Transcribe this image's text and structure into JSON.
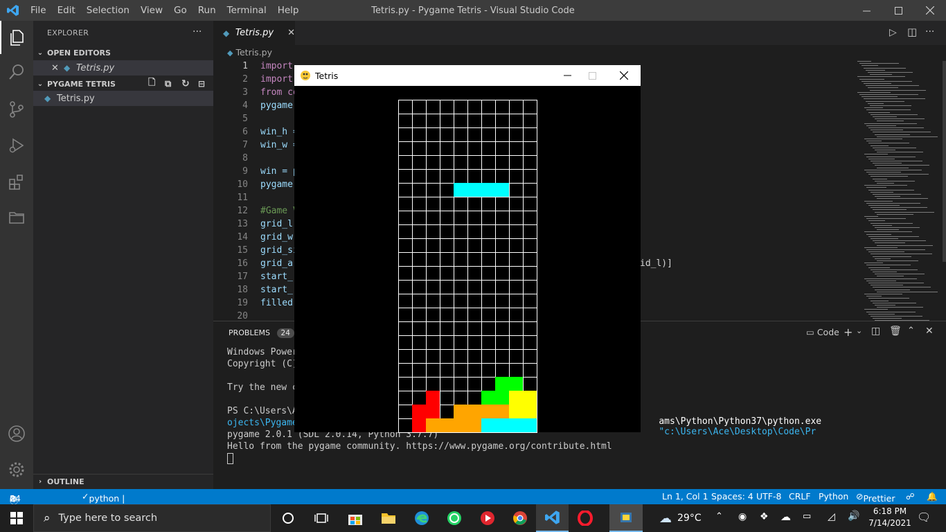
{
  "window": {
    "title": "Tetris.py - Pygame Tetris - Visual Studio Code",
    "menu": [
      "File",
      "Edit",
      "Selection",
      "View",
      "Go",
      "Run",
      "Terminal",
      "Help"
    ]
  },
  "sidebar": {
    "header": "EXPLORER",
    "open_editors_label": "OPEN EDITORS",
    "open_editor_file": "Tetris.py",
    "folder_label": "PYGAME TETRIS",
    "folder_file": "Tetris.py",
    "outline_label": "OUTLINE"
  },
  "editor": {
    "tab_label": "Tetris.py",
    "breadcrumb": "Tetris.py",
    "lines": [
      {
        "num": "1",
        "text": "import"
      },
      {
        "num": "2",
        "text": "import"
      },
      {
        "num": "3",
        "text": "from co"
      },
      {
        "num": "4",
        "text": "pygame"
      },
      {
        "num": "5",
        "text": ""
      },
      {
        "num": "6",
        "text": "win_h ="
      },
      {
        "num": "7",
        "text": "win_w ="
      },
      {
        "num": "8",
        "text": ""
      },
      {
        "num": "9",
        "text": "win = p"
      },
      {
        "num": "10",
        "text": "pygame"
      },
      {
        "num": "11",
        "text": ""
      },
      {
        "num": "12",
        "text": "#Game V"
      },
      {
        "num": "13",
        "text": "grid_l"
      },
      {
        "num": "14",
        "text": "grid_w"
      },
      {
        "num": "15",
        "text": "grid_si"
      },
      {
        "num": "16",
        "text": "grid_ar"
      },
      {
        "num": "17",
        "text": "start_"
      },
      {
        "num": "18",
        "text": "start_"
      },
      {
        "num": "19",
        "text": "filled"
      },
      {
        "num": "20",
        "text": ""
      }
    ],
    "line16_tail": "id_l)]"
  },
  "panel": {
    "problems_label": "PROBLEMS",
    "problems_count": "24",
    "terminal_name": "Code",
    "lines": [
      "Windows PowerS",
      "Copyright (C)",
      "",
      "Try the new cr",
      "",
      "PS C:\\Users\\Ac",
      "ojects\\Pygame",
      "pygame 2.0.1 (SDL 2.0.14, Python 3.7.7)",
      "Hello from the pygame community. https://www.pygame.org/contribute.html"
    ],
    "ps_tail_white": "ams\\Python\\Python37\\python.exe",
    "ps_tail_cyan": "\"c:\\Users\\Ace\\Desktop\\Code\\Pr"
  },
  "statusbar": {
    "errors": "0",
    "warnings": "0",
    "infos": "24",
    "interpreter": "python | ✓ Tetris.py",
    "position": "Ln 1, Col 1",
    "spaces": "Spaces: 4",
    "encoding": "UTF-8",
    "eol": "CRLF",
    "language": "Python",
    "formatter": "Prettier"
  },
  "taskbar": {
    "search_placeholder": "Type here to search",
    "weather": "29°C",
    "time": "6:18 PM",
    "date": "7/14/2021"
  },
  "game": {
    "title": "Tetris",
    "grid_cols": 10,
    "grid_rows": 24,
    "colors": {
      "cyan": "#00ffff",
      "green": "#00ff00",
      "yellow": "#ffff00",
      "red": "#ff0000",
      "orange": "#ffa500"
    },
    "cells": [
      {
        "r": 6,
        "c": 4,
        "color": "cyan"
      },
      {
        "r": 6,
        "c": 5,
        "color": "cyan"
      },
      {
        "r": 6,
        "c": 6,
        "color": "cyan"
      },
      {
        "r": 6,
        "c": 7,
        "color": "cyan"
      },
      {
        "r": 20,
        "c": 7,
        "color": "green"
      },
      {
        "r": 20,
        "c": 8,
        "color": "green"
      },
      {
        "r": 21,
        "c": 6,
        "color": "green"
      },
      {
        "r": 21,
        "c": 7,
        "color": "green"
      },
      {
        "r": 21,
        "c": 8,
        "color": "yellow"
      },
      {
        "r": 21,
        "c": 9,
        "color": "yellow"
      },
      {
        "r": 22,
        "c": 8,
        "color": "yellow"
      },
      {
        "r": 22,
        "c": 9,
        "color": "yellow"
      },
      {
        "r": 21,
        "c": 2,
        "color": "red"
      },
      {
        "r": 22,
        "c": 1,
        "color": "red"
      },
      {
        "r": 22,
        "c": 2,
        "color": "red"
      },
      {
        "r": 23,
        "c": 1,
        "color": "red"
      },
      {
        "r": 22,
        "c": 4,
        "color": "orange"
      },
      {
        "r": 22,
        "c": 5,
        "color": "orange"
      },
      {
        "r": 22,
        "c": 6,
        "color": "orange"
      },
      {
        "r": 22,
        "c": 7,
        "color": "orange"
      },
      {
        "r": 23,
        "c": 2,
        "color": "orange"
      },
      {
        "r": 23,
        "c": 3,
        "color": "orange"
      },
      {
        "r": 23,
        "c": 4,
        "color": "orange"
      },
      {
        "r": 23,
        "c": 5,
        "color": "orange"
      },
      {
        "r": 23,
        "c": 6,
        "color": "cyan"
      },
      {
        "r": 23,
        "c": 7,
        "color": "cyan"
      },
      {
        "r": 23,
        "c": 8,
        "color": "cyan"
      },
      {
        "r": 23,
        "c": 9,
        "color": "cyan"
      }
    ]
  }
}
